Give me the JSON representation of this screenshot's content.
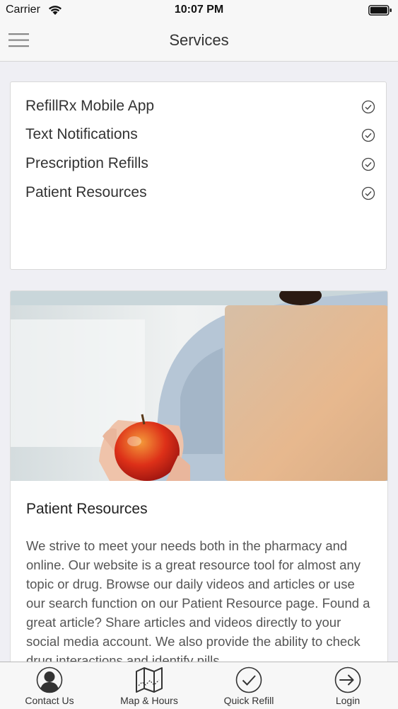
{
  "status_bar": {
    "carrier": "Carrier",
    "time": "10:07 PM"
  },
  "nav": {
    "title": "Services"
  },
  "services": [
    {
      "label": "RefillRx Mobile App"
    },
    {
      "label": "Text Notifications"
    },
    {
      "label": "Prescription Refills"
    },
    {
      "label": "Patient Resources"
    }
  ],
  "resource": {
    "title": "Patient Resources",
    "body": "We strive to meet your needs both in the pharmacy and online. Our website is a great resource tool for almost any topic or drug. Browse our daily videos and articles or use our search function on our Patient Resource page. Found a great article? Share articles and videos directly to your social media account. We also provide the ability to check drug interactions and identify pills."
  },
  "tabs": [
    {
      "label": "Contact Us",
      "icon": "person-icon"
    },
    {
      "label": "Map & Hours",
      "icon": "map-icon"
    },
    {
      "label": "Quick Refill",
      "icon": "check-circle-icon"
    },
    {
      "label": "Login",
      "icon": "login-icon"
    }
  ]
}
